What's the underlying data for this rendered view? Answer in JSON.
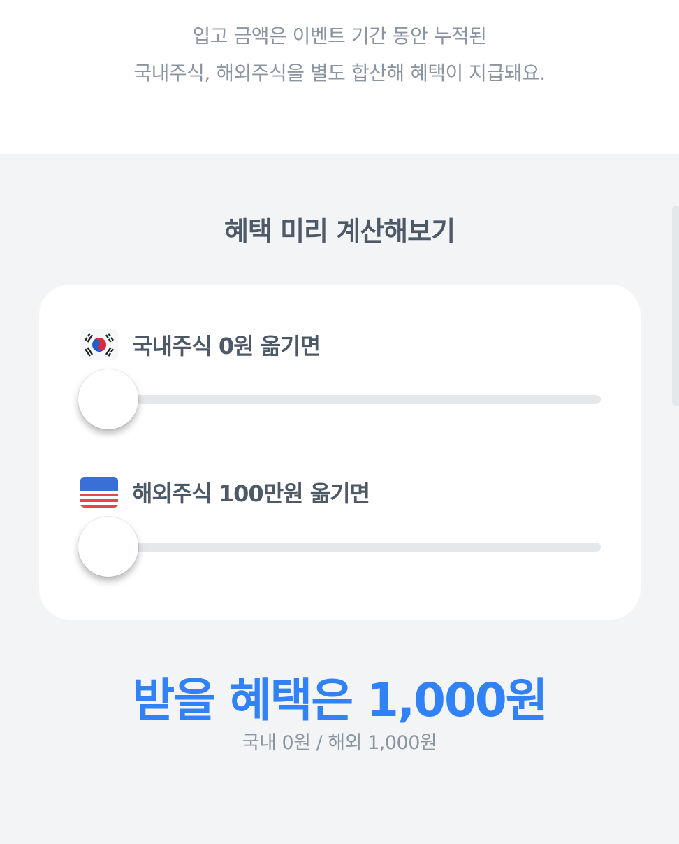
{
  "notice": {
    "line1": "입고 금액은 이벤트 기간 동안 누적된",
    "line2": "국내주식, 해외주식을 별도 합산해 혜택이 지급돼요."
  },
  "calculator": {
    "title": "혜택 미리 계산해보기",
    "domestic": {
      "label": "국내주식 0원 옮기면",
      "flag_icon": "korea-flag-icon",
      "slider_value": 0
    },
    "overseas": {
      "label": "해외주식 100만원 옮기면",
      "flag_icon": "usa-flag-icon",
      "slider_value": 0
    }
  },
  "result": {
    "headline": "받을 혜택은 1,000원",
    "breakdown": "국내 0원 / 해외 1,000원"
  },
  "colors": {
    "accent": "#3182f6",
    "text_primary": "#4e5968",
    "text_secondary": "#8b95a1",
    "section_bg": "#f2f4f6",
    "track": "#e5e8eb"
  }
}
